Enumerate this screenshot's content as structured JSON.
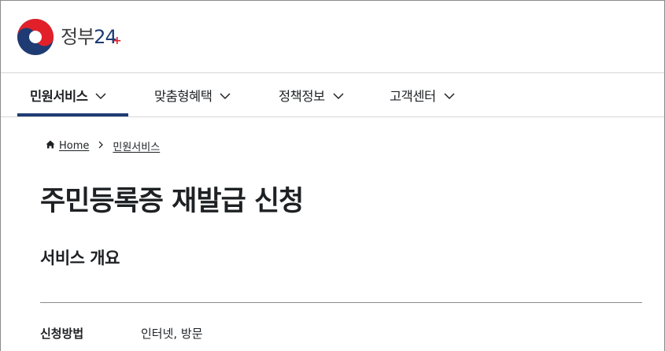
{
  "header": {
    "logo_text": "정부",
    "logo_number": "24",
    "logo_plus": "+"
  },
  "nav": {
    "items": [
      {
        "label": "민원서비스",
        "active": true
      },
      {
        "label": "맞춤형혜택",
        "active": false
      },
      {
        "label": "정책정보",
        "active": false
      },
      {
        "label": "고객센터",
        "active": false
      }
    ]
  },
  "breadcrumb": {
    "home": "Home",
    "current": "민원서비스"
  },
  "main": {
    "title": "주민등록증 재발급 신청",
    "section_title": "서비스 개요",
    "info": [
      {
        "label": "신청방법",
        "value": "인터넷, 방문"
      }
    ]
  },
  "colors": {
    "brand_navy": "#1f3b73",
    "brand_red": "#e2202a",
    "text": "#1e2124",
    "border": "#d6d6d6"
  }
}
